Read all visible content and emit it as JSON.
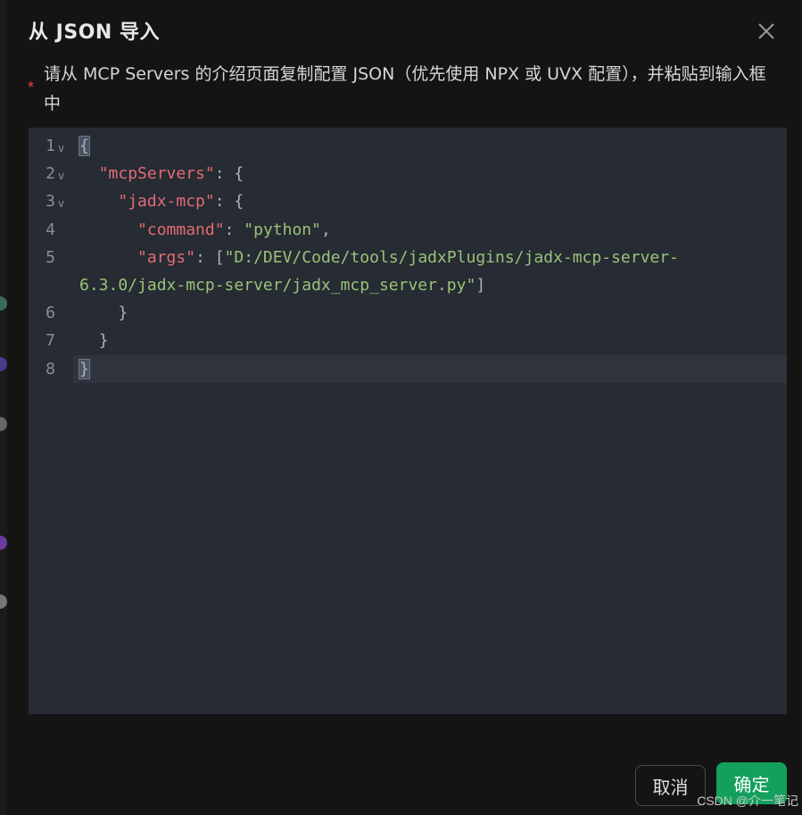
{
  "dialog": {
    "title": "从 JSON 导入",
    "required_mark": "*",
    "description": "请从 MCP Servers 的介绍页面复制配置 JSON（优先使用 NPX 或 UVX 配置），并粘贴到输入框中",
    "close_icon": "close-icon"
  },
  "editor": {
    "lines": [
      {
        "number": "1",
        "fold": "v"
      },
      {
        "number": "2",
        "fold": "v"
      },
      {
        "number": "3",
        "fold": "v"
      },
      {
        "number": "4",
        "fold": ""
      },
      {
        "number": "5",
        "fold": ""
      },
      {
        "number": "6",
        "fold": ""
      },
      {
        "number": "7",
        "fold": ""
      },
      {
        "number": "8",
        "fold": ""
      }
    ],
    "tokens": {
      "open_brace": "{",
      "mcp_servers_key": "\"mcpServers\"",
      "server_name_key": "\"jadx-mcp\"",
      "command_key": "\"command\"",
      "command_value": "\"python\"",
      "args_key": "\"args\"",
      "args_value_part1": "\"D:/DEV/Code/tools/jadxPlugins/jadx-mcp-server-",
      "args_value_part2": "6.3.0/jadx-mcp-server/jadx_mcp_server.py\"",
      "close_brace": "}"
    }
  },
  "footer": {
    "cancel_label": "取消",
    "ok_label": "确定"
  },
  "watermark": "CSDN @介一笔记",
  "colors": {
    "accent": "#12a05c",
    "key": "#e06c75",
    "string": "#98c379",
    "required": "#e0443e"
  }
}
